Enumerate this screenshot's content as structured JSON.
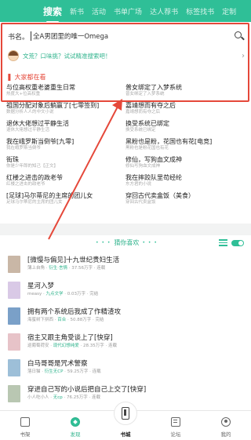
{
  "top_tabs": [
    {
      "label": "搜索",
      "active": true
    },
    {
      "label": "新书"
    },
    {
      "label": "活动"
    },
    {
      "label": "书单广场"
    },
    {
      "label": "达人荐书"
    },
    {
      "label": "标签找书"
    },
    {
      "label": "定制"
    }
  ],
  "search": {
    "prefix": "书名。",
    "value": "全A男团里的唯一Omega",
    "tip": "文荒？口味挑？试试精准搜索吧！"
  },
  "hot_section": {
    "title": "大家都在看",
    "books": [
      {
        "title": "与位高权重老婆重生日常",
        "sub": "热度大+位高权重"
      },
      {
        "title": "普女绑定了入梦系统",
        "sub": "普女绑定了入梦系统"
      },
      {
        "title": "祖国分配对象后躺赢了[七零签到]",
        "sub": "数据分析人人的中文小说"
      },
      {
        "title": "嘉靖想而有夺之后",
        "sub": "嘉靖想而有夺之后"
      },
      {
        "title": "退休大佬想过平静生活",
        "sub": "退休大佬想过平静生活"
      },
      {
        "title": "换受系统已绑定",
        "sub": "换受系统已绑定"
      },
      {
        "title": "我在峨罗斯当倒爷[九零]",
        "sub": "我在峨罗斯当倒爷"
      },
      {
        "title": "黑粉也是粉，花国也有花[电竞]",
        "sub": "黑粉也是粉花国也有花"
      },
      {
        "title": "街珠",
        "sub": "你是少年郎的知己【正文】"
      },
      {
        "title": "修仙，写狗血文成神",
        "sub": "修仙写狗血文成神"
      },
      {
        "title": "红楼之进击的政老爷",
        "sub": "红楼之进击的政老爷"
      },
      {
        "title": "我在摔跤队里苟经纶",
        "sub": "东方君的小说"
      },
      {
        "title": "[足球]马尔蒂尼的主席的团儿女",
        "sub": "足球马尔蒂尼的主席的团儿女"
      },
      {
        "title": "穿回古代卖盒饭（美食）",
        "sub": "穿回古代卖盒饭"
      }
    ]
  },
  "recommend": {
    "title": "猜你喜欢",
    "dots": "• • •",
    "items": [
      {
        "title": "[微慢与偏见]十九世纪贵妇生活",
        "author": "薄上自角",
        "tag": "衍生·言情",
        "stats": "37.56万字 · 连载",
        "cover": "#c9b7a6"
      },
      {
        "title": "星河入梦",
        "author": "measy",
        "tag": "九点文学",
        "stats": "0.03万字 · 完结",
        "cover": "#d9c9e6"
      },
      {
        "title": "拥有两个系统后我成了作精渣攻",
        "author": "海蜜树下拼西",
        "tag": "百合",
        "stats": "50.88万字 · 完结",
        "cover": "#7aa0c8"
      },
      {
        "title": "宿主又跟主角受谈上了[快穿]",
        "author": "巡葡萄荷安",
        "tag": "现代幻想纯爱",
        "stats": "28.35万字 · 连载",
        "cover": "#e7c3c8"
      },
      {
        "title": "白马哥哥是咒术警察",
        "author": "落日猫",
        "tag": "衍生无CP",
        "stats": "59.25万字 · 连载",
        "cover": "#9dbfd8"
      },
      {
        "title": "穿进自己写的小说后把自己上交了[快穿]",
        "author": "小人吃小人",
        "tag": "无cp",
        "stats": "76.25万字 · 连载",
        "cover": "#b9c7b2"
      }
    ]
  },
  "bottom_nav": [
    {
      "label": "书架",
      "icon": "bookshelf-icon"
    },
    {
      "label": "发现",
      "icon": "discover-icon",
      "active": true
    },
    {
      "label": "书城",
      "icon": "bookcity-icon"
    },
    {
      "label": "论坛",
      "icon": "forum-icon"
    },
    {
      "label": "我的",
      "icon": "profile-icon"
    }
  ],
  "colors": {
    "brand": "#2fbf97",
    "highlight_box": "#e5483a"
  }
}
